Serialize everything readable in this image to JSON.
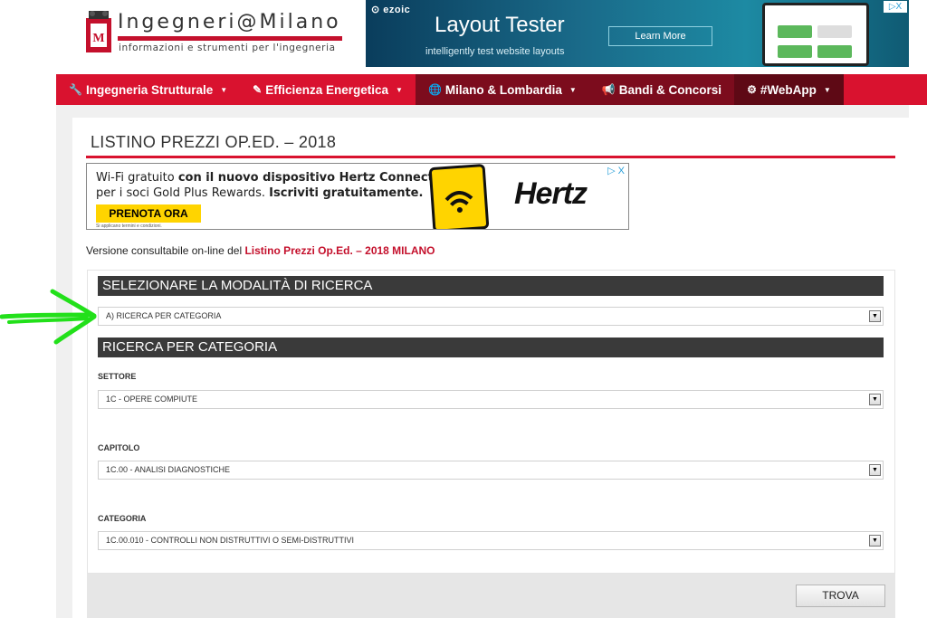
{
  "header": {
    "logo_title": "Ingegneri@Milano",
    "logo_subtitle": "informazioni e strumenti per l'ingegneria"
  },
  "top_ad": {
    "brand": "⊙ ezoic",
    "title": "Layout Tester",
    "subtitle": "intelligently test website layouts",
    "button": "Learn More",
    "adchoice": "▷X"
  },
  "nav": {
    "items": [
      {
        "icon": "🔧",
        "label": "Ingegneria Strutturale",
        "caret": "▼"
      },
      {
        "icon": "✎",
        "label": "Efficienza Energetica",
        "caret": "▼"
      },
      {
        "icon": "🌐",
        "label": "Milano & Lombardia",
        "caret": "▼"
      },
      {
        "icon": "📢",
        "label": "Bandi & Concorsi",
        "caret": ""
      },
      {
        "icon": "⚙",
        "label": "#WebApp",
        "caret": "▼"
      }
    ]
  },
  "page": {
    "title": "LISTINO PREZZI OP.ED. – 2018",
    "version_prefix": "Versione consultabile on-line del ",
    "version_link": "Listino Prezzi Op.Ed. – 2018  MILANO"
  },
  "hertz_ad": {
    "line1_a": "Wi-Fi gratuito ",
    "line1_b": "con il nuovo dispositivo Hertz Connect",
    "line2_a": "per i soci Gold Plus Rewards. ",
    "line2_b": "Iscriviti gratuitamente.",
    "button": "PRENOTA ORA",
    "fine": "Si applicano termini e condizioni.",
    "logo": "Hertz",
    "adchoice": "▷ X"
  },
  "search": {
    "mode_header": "SELEZIONARE LA MODALITÀ DI RICERCA",
    "mode_value": "A) RICERCA PER CATEGORIA",
    "category_header": "RICERCA PER CATEGORIA",
    "settore_label": "SETTORE",
    "settore_value": "1C - OPERE COMPIUTE",
    "capitolo_label": "CAPITOLO",
    "capitolo_value": "1C.00 - ANALISI DIAGNOSTICHE",
    "categoria_label": "CATEGORIA",
    "categoria_value": "1C.00.010 - CONTROLLI NON DISTRUTTIVI O SEMI-DISTRUTTIVI",
    "dropdown_arrow": "▼",
    "button": "TROVA"
  },
  "colors": {
    "brand_red": "#d9122f",
    "nav_dark": "#7c0c1d",
    "header_dark": "#3a3a3a",
    "annotation_green": "#22e01a"
  }
}
